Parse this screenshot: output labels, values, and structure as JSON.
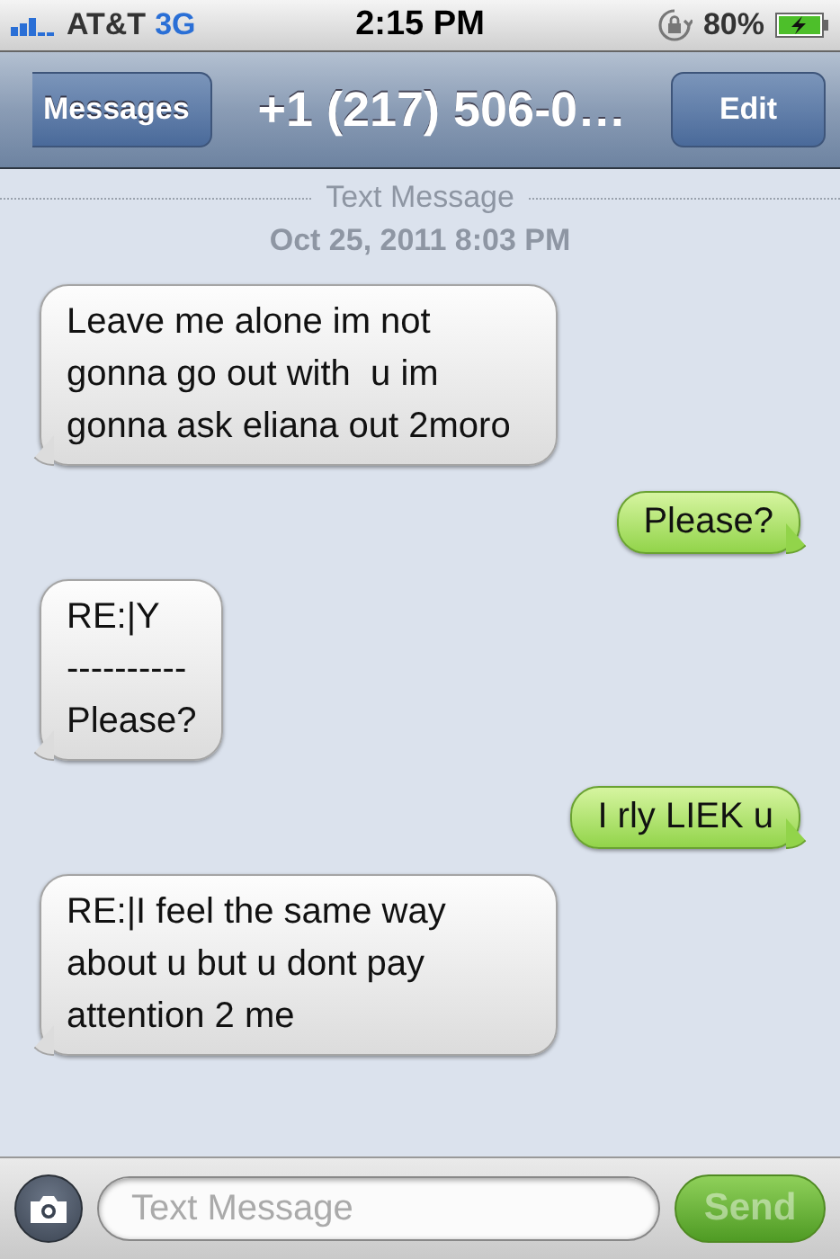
{
  "status_bar": {
    "carrier": "AT&T",
    "network": "3G",
    "time": "2:15 PM",
    "battery": "80%"
  },
  "nav_bar": {
    "back": "Messages",
    "title": "+1 (217) 506-0…",
    "action": "Edit"
  },
  "header": {
    "label": "Text Message",
    "date": "Oct 25, 2011 8:03 PM"
  },
  "messages": [
    {
      "kind": "received",
      "text": "Leave me alone im not gonna go out with  u im gonna ask eliana out 2moro"
    },
    {
      "kind": "sent",
      "text": "Please?"
    },
    {
      "kind": "received",
      "text": "RE:|Y\n----------\nPlease?"
    },
    {
      "kind": "sent",
      "text": "I rly LIEK u"
    },
    {
      "kind": "received",
      "text": "RE:|I feel the same way about u but u dont pay attention 2 me"
    }
  ],
  "composer": {
    "placeholder": "Text Message",
    "send": "Send",
    "send_disabled": true
  }
}
